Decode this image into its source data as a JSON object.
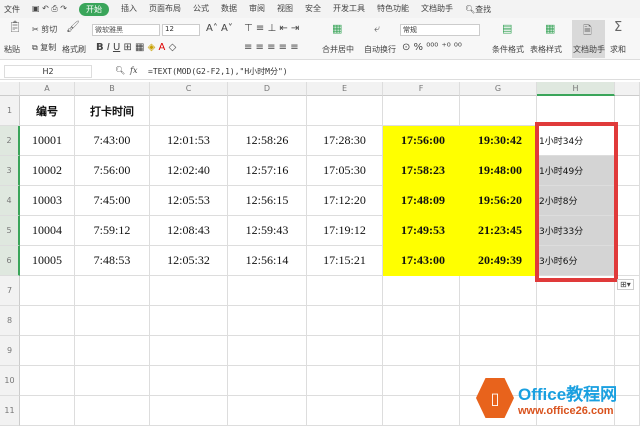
{
  "menu": {
    "file": "文件",
    "tabs": [
      "开始",
      "插入",
      "页面布局",
      "公式",
      "数据",
      "审阅",
      "视图",
      "安全",
      "开发工具",
      "特色功能",
      "文档助手"
    ],
    "search": "查找"
  },
  "ribbon": {
    "paste": "粘贴",
    "cut": "剪切",
    "copy": "复制",
    "format_painter": "格式刷",
    "font": "微软雅黑",
    "size": "12",
    "merge": "合并居中",
    "wrap": "自动换行",
    "number_format": "常规",
    "conditional": "条件格式",
    "table_style": "表格样式",
    "doc_helper": "文档助手",
    "sum": "求和"
  },
  "formula_bar": {
    "cell_ref": "H2",
    "fx": "fx",
    "formula": "=TEXT(MOD(G2-F2,1),\"H小时M分\")"
  },
  "columns": [
    "A",
    "B",
    "C",
    "D",
    "E",
    "F",
    "G",
    "H"
  ],
  "rows": [
    "1",
    "2",
    "3",
    "4",
    "5",
    "6",
    "7",
    "8",
    "9",
    "10",
    "11"
  ],
  "header_row": [
    "编号",
    "打卡时间",
    "",
    "",
    "",
    "",
    "",
    ""
  ],
  "data": [
    [
      "10001",
      "7:43:00",
      "12:01:53",
      "12:58:26",
      "17:28:30",
      "17:56:00",
      "19:30:42",
      "1小时34分"
    ],
    [
      "10002",
      "7:56:00",
      "12:02:40",
      "12:57:16",
      "17:05:30",
      "17:58:23",
      "19:48:00",
      "1小时49分"
    ],
    [
      "10003",
      "7:45:00",
      "12:05:53",
      "12:56:15",
      "17:12:20",
      "17:48:09",
      "19:56:20",
      "2小时8分"
    ],
    [
      "10004",
      "7:59:12",
      "12:08:43",
      "12:59:43",
      "17:19:12",
      "17:49:53",
      "21:23:45",
      "3小时33分"
    ],
    [
      "10005",
      "7:48:53",
      "12:05:32",
      "12:56:14",
      "17:15:21",
      "17:43:00",
      "20:49:39",
      "3小时6分"
    ]
  ],
  "highlight_color": "#ffff00",
  "accent": "#3aa55a",
  "watermark": {
    "title": "Office教程网",
    "url": "www.office26.com"
  }
}
